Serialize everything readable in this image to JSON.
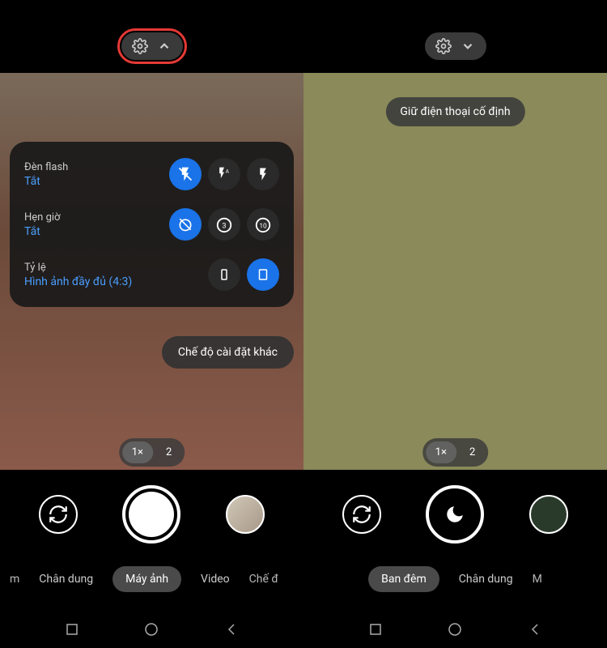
{
  "left": {
    "toast": null,
    "settings": {
      "flash": {
        "title": "Đèn flash",
        "value": "Tắt"
      },
      "timer": {
        "title": "Hẹn giờ",
        "value": "Tắt"
      },
      "ratio": {
        "title": "Tỷ lệ",
        "value": "Hình ảnh đầy đủ (4:3)"
      }
    },
    "more_settings_label": "Chế độ cài đặt khác",
    "zoom": {
      "active": "1×",
      "other": "2"
    },
    "modes": {
      "partial_start": "m",
      "items": [
        "Chân dung",
        "Máy ảnh",
        "Video"
      ],
      "partial_end": "Chế đ",
      "active_index": 1
    }
  },
  "right": {
    "toast": "Giữ điện thoại cố định",
    "zoom": {
      "active": "1×",
      "other": "2"
    },
    "modes": {
      "items": [
        "Ban đêm",
        "Chân dung"
      ],
      "partial_end": "M",
      "active_index": 0
    }
  },
  "timer_options": [
    "3",
    "10"
  ],
  "colors": {
    "accent": "#1a73e8",
    "link": "#4a9eff",
    "highlight": "#e53935"
  }
}
